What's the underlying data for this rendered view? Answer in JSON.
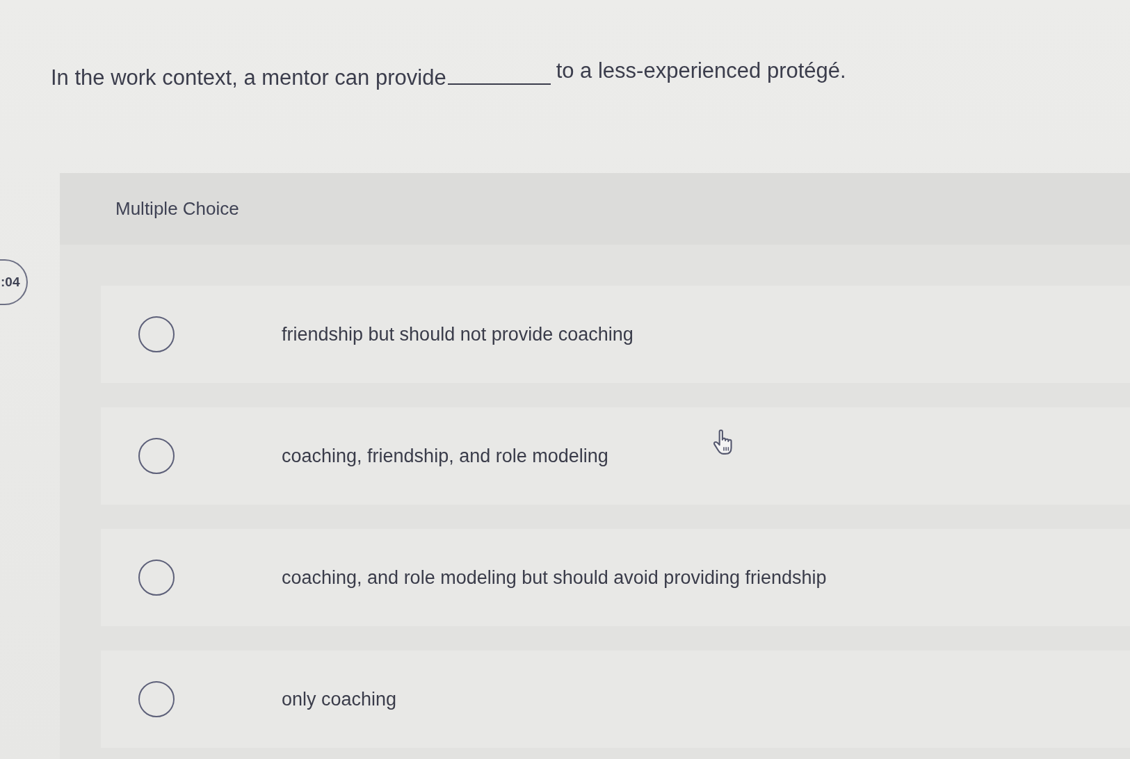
{
  "timer": {
    "text": ":04"
  },
  "question": {
    "text_before": "In the work context, a mentor can provide",
    "text_after": "to a less-experienced protégé."
  },
  "question_type": "Multiple Choice",
  "options": [
    {
      "label": "friendship but should not provide coaching",
      "selected": false
    },
    {
      "label": "coaching, friendship, and role modeling",
      "selected": false
    },
    {
      "label": "coaching, and role modeling but should avoid providing friendship",
      "selected": false
    },
    {
      "label": "only coaching",
      "selected": false
    }
  ]
}
